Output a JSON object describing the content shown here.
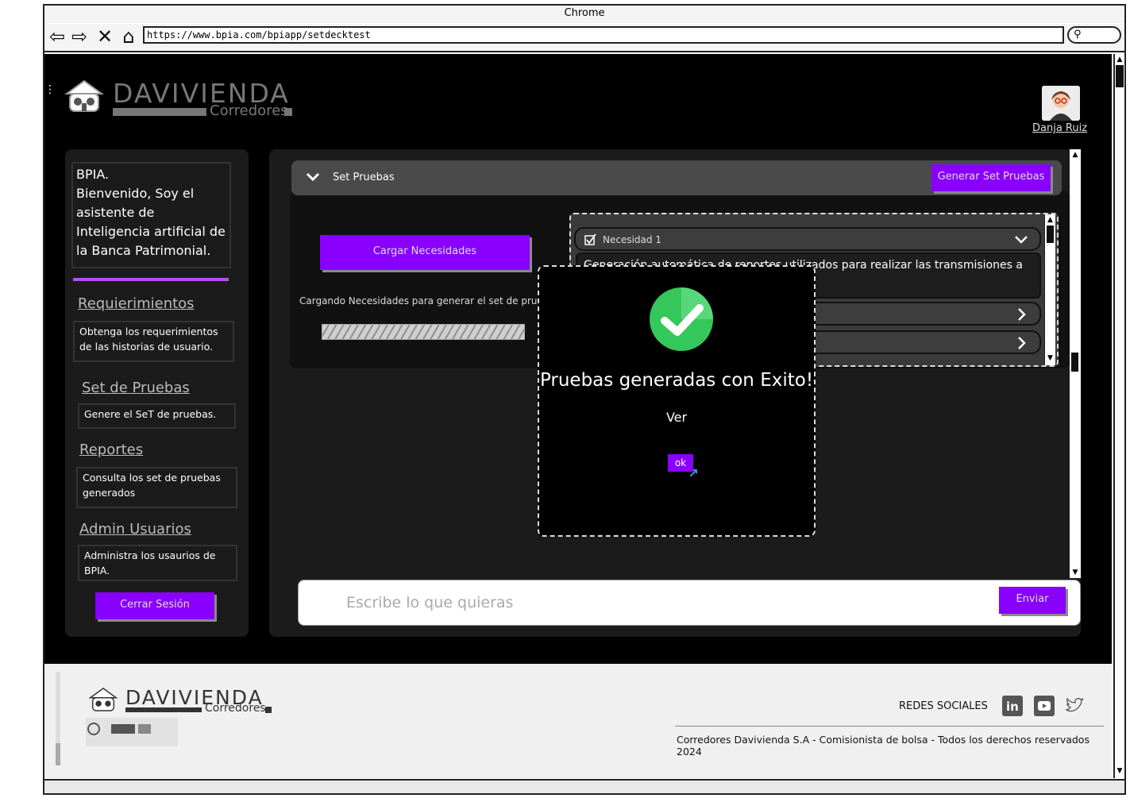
{
  "browser": {
    "title": "Chrome",
    "url": "https://www.bpia.com/bpiapp/setdecktest",
    "search_icon": "search-icon"
  },
  "header": {
    "brand": "DAVIVIENDA",
    "brand_sub": "Corredores",
    "user_name": "Danja Ruiz"
  },
  "sidebar": {
    "intro": "BPIA.\nBienvenido, Soy el asistente de Inteligencia artificial de la Banca Patrimonial.",
    "items": [
      {
        "label": "Requierimientos",
        "desc": "Obtenga los requerimientos de las historias de usuario."
      },
      {
        "label": "Set de Pruebas",
        "desc": "Genere el SeT de pruebas."
      },
      {
        "label": "Reportes",
        "desc": "Consulta los set de pruebas generados"
      },
      {
        "label": "Admin Usuarios",
        "desc": "Administra los usaurios de BPIA."
      }
    ],
    "logout_label": "Cerrar Sesión"
  },
  "main": {
    "section_title": "Set Pruebas",
    "generate_label": "Generar Set Pruebas",
    "load_label": "Cargar Necesidades",
    "loading_text": "Cargando Necesidades para generar el set de pruebas",
    "needs": [
      {
        "label": "Necesidad 1",
        "expanded": true,
        "desc": "Generación automática de reportes utilizados para realizar las transmisiones a la"
      },
      {
        "label": "",
        "expanded": false
      },
      {
        "label": "",
        "expanded": false
      }
    ],
    "chat_placeholder": "Escribe lo que quieras",
    "send_label": "Enviar"
  },
  "modal": {
    "title": "Pruebas generadas con Exito!",
    "link": "Ver",
    "ok_label": "ok"
  },
  "footer": {
    "brand": "DAVIVIENDA",
    "brand_sub": "Corredores",
    "social_label": "REDES SOCIALES",
    "social_icons": [
      "linkedin-icon",
      "youtube-icon",
      "twitter-icon"
    ],
    "copyright": "Corredores Davivienda S.A - Comisionista de bolsa - Todos los derechos reservados 2024"
  },
  "colors": {
    "accent": "#8a00ff",
    "success": "#34c759",
    "background": "#000000"
  }
}
